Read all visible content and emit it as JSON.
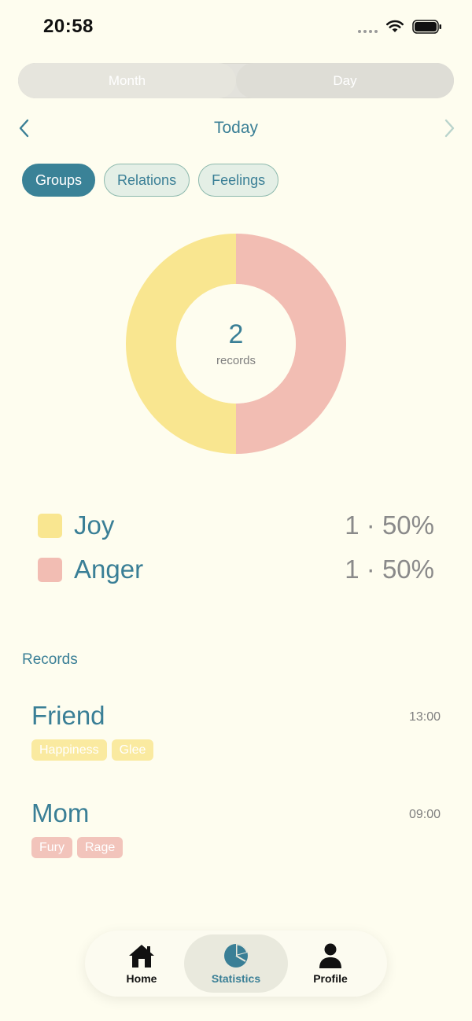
{
  "status_bar": {
    "time": "20:58"
  },
  "segmented": {
    "month_label": "Month",
    "day_label": "Day"
  },
  "date_nav": {
    "label": "Today"
  },
  "filters": [
    {
      "label": "Groups",
      "active": true
    },
    {
      "label": "Relations",
      "active": false
    },
    {
      "label": "Feelings",
      "active": false
    }
  ],
  "summary": {
    "count": "2",
    "unit": "records"
  },
  "chart_data": {
    "type": "pie",
    "categories": [
      "Joy",
      "Anger"
    ],
    "values": [
      1,
      1
    ],
    "colors": [
      "#F9E690",
      "#F2BDB3"
    ]
  },
  "legend": [
    {
      "name": "Joy",
      "value": "1 · 50%",
      "color": "#F9E690"
    },
    {
      "name": "Anger",
      "value": "1 · 50%",
      "color": "#F2BDB3"
    }
  ],
  "records_section": {
    "title": "Records"
  },
  "records": [
    {
      "title": "Friend",
      "time": "13:00",
      "tags": [
        "Happiness",
        "Glee"
      ],
      "group": "joy"
    },
    {
      "title": "Mom",
      "time": "09:00",
      "tags": [
        "Fury",
        "Rage"
      ],
      "group": "anger"
    }
  ],
  "tabbar": [
    {
      "label": "Home",
      "icon": "home-icon",
      "active": false
    },
    {
      "label": "Statistics",
      "icon": "pie-chart-icon",
      "active": true
    },
    {
      "label": "Profile",
      "icon": "person-icon",
      "active": false
    }
  ],
  "colors": {
    "accent": "#3A8297",
    "background": "#FEFDEF"
  }
}
